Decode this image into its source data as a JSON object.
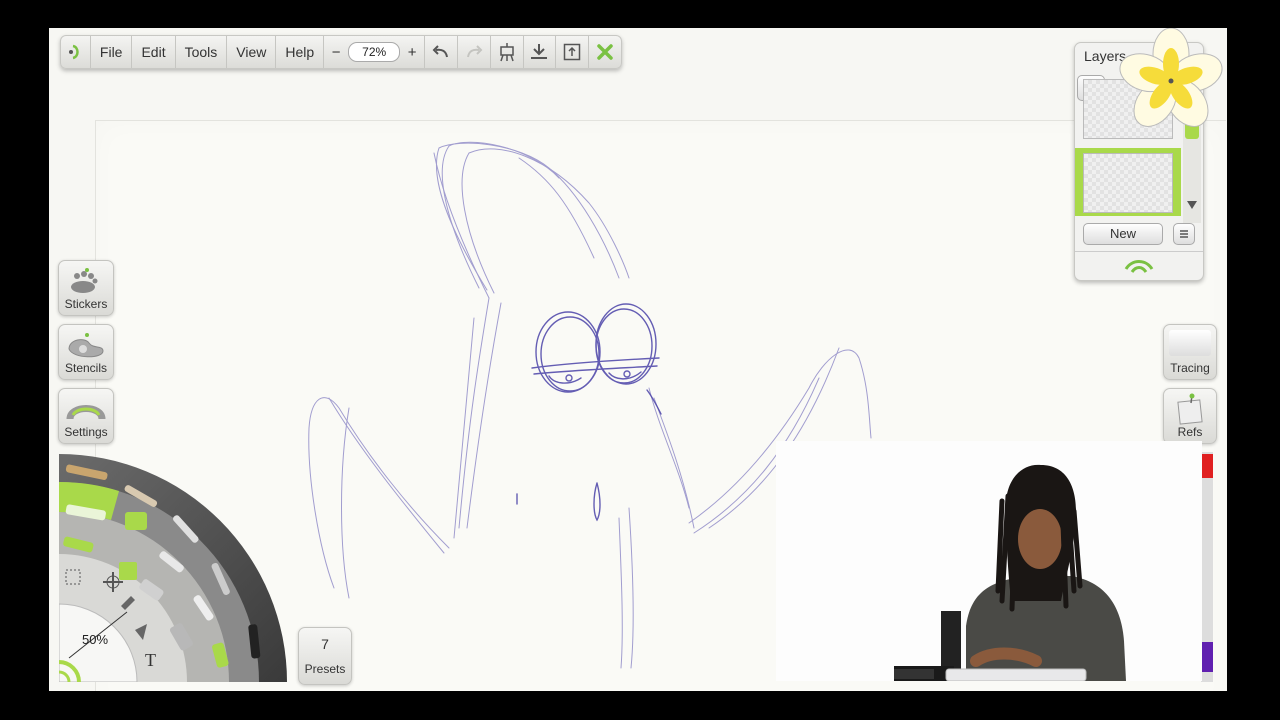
{
  "menu": {
    "items": [
      "File",
      "Edit",
      "Tools",
      "View",
      "Help"
    ],
    "zoom_minus": "−",
    "zoom_value": "72%",
    "zoom_plus": "+"
  },
  "side": {
    "stickers": "Stickers",
    "stencils": "Stencils",
    "settings": "Settings"
  },
  "wheel": {
    "size_percent": "50%",
    "text_tool": "T"
  },
  "presets": {
    "count": "7",
    "label": "Presets"
  },
  "layers": {
    "title": "Layers",
    "new_label": "New"
  },
  "right": {
    "tracing": "Tracing",
    "refs": "Refs"
  },
  "colors": {
    "accent": "#a9d94a",
    "sketch": "#5a52b0",
    "close": "#7ac142"
  }
}
